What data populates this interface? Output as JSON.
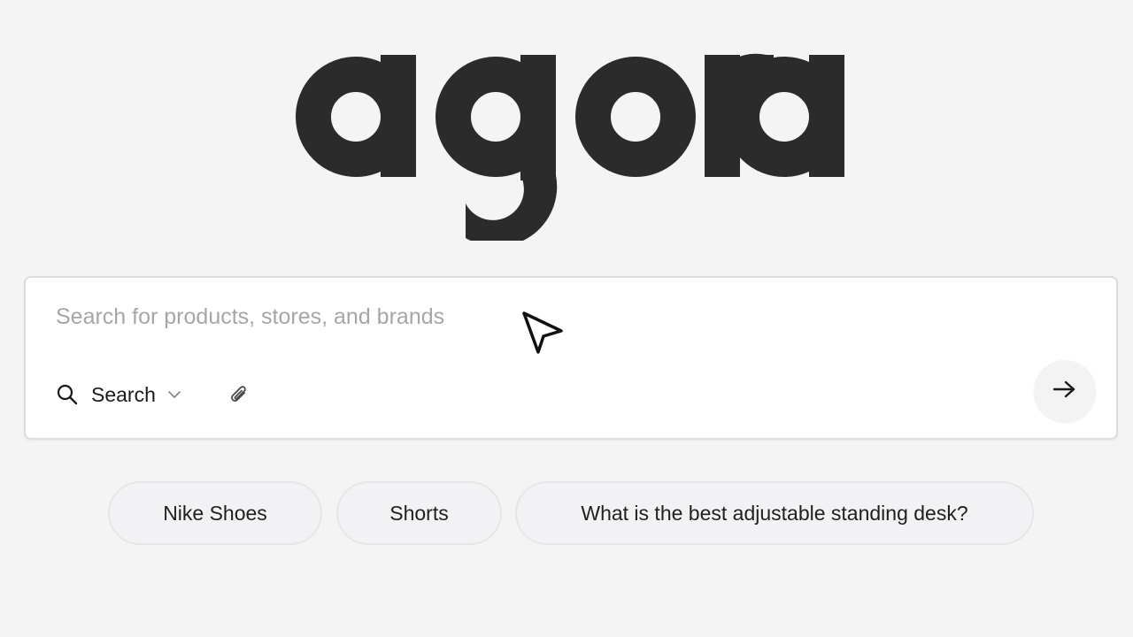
{
  "brand": {
    "logo_text": "agora",
    "logo_color": "#2b2b2b"
  },
  "search": {
    "placeholder": "Search for products, stores, and brands",
    "value": "",
    "mode_label": "Search",
    "mode_icon": "search-icon",
    "attach_icon": "paperclip-icon",
    "submit_icon": "arrow-right-icon"
  },
  "suggestions": [
    {
      "label": "Nike Shoes"
    },
    {
      "label": "Shorts"
    },
    {
      "label": "What is the best adjustable standing desk?"
    }
  ],
  "colors": {
    "background": "#f4f4f5",
    "card": "#ffffff",
    "placeholder": "#a6a6a9",
    "chip_bg": "#f2f2f4"
  }
}
